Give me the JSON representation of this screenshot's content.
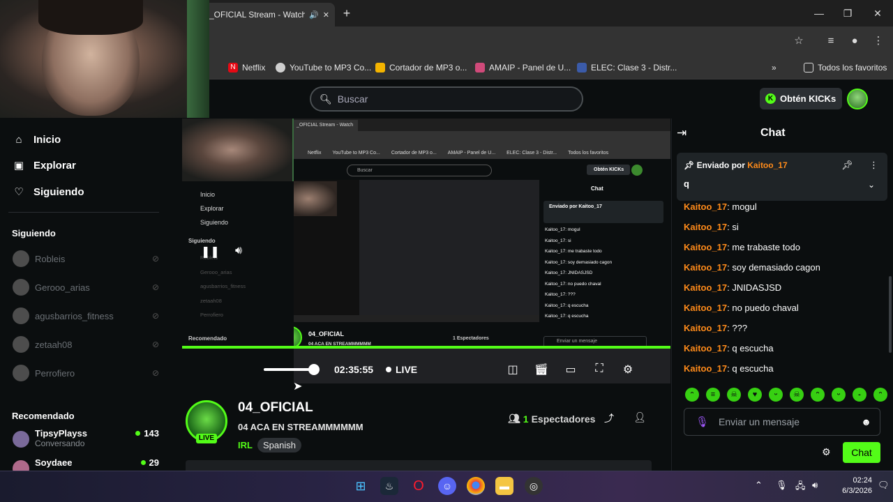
{
  "browser": {
    "tab_title": "_OFICIAL Stream - Watch",
    "bookmarks": [
      {
        "label": "Netflix",
        "color": "#e50914"
      },
      {
        "label": "YouTube to MP3 Co...",
        "color": "#cfcfcf"
      },
      {
        "label": "Cortador de MP3 o...",
        "color": "#f4b400"
      },
      {
        "label": "AMAIP - Panel de U...",
        "color": "#d04a7a"
      },
      {
        "label": "ELEC: Clase 3 - Distr...",
        "color": "#3b5ba9"
      }
    ],
    "all_bookmarks": "Todos los favoritos"
  },
  "header": {
    "search_placeholder": "Buscar",
    "kicks_label": "Obtén KICKs"
  },
  "sidebar": {
    "nav": [
      {
        "label": "Inicio",
        "icon": "home-icon"
      },
      {
        "label": "Explorar",
        "icon": "explore-icon"
      },
      {
        "label": "Siguiendo",
        "icon": "heart-icon"
      }
    ],
    "following_title": "Siguiendo",
    "following": [
      "Robleis",
      "Gerooo_arias",
      "agusbarrios_fitness",
      "zetaah08",
      "Perrofiero"
    ],
    "recommended_title": "Recomendado",
    "recommended": [
      {
        "name": "TipsyPlayss",
        "sub": "Conversando",
        "count": "143"
      },
      {
        "name": "Soydaee",
        "sub": "",
        "count": "29"
      }
    ]
  },
  "player": {
    "time": "02:35:55",
    "live": "LIVE"
  },
  "stream": {
    "channel": "04_OFICIAL",
    "title": "04 ACA EN STREAMMMMMM",
    "category": "IRL",
    "tag": "Spanish",
    "live_badge": "LIVE",
    "viewer_count": "1",
    "viewer_label": "Espectadores"
  },
  "chat": {
    "title": "Chat",
    "pinned_by": "Enviado por",
    "pinned_user": "Kaitoo_17",
    "pinned_msg": "q",
    "messages": [
      {
        "user": "Kaitoo_17",
        "text": ": mogul"
      },
      {
        "user": "Kaitoo_17",
        "text": ": si"
      },
      {
        "user": "Kaitoo_17",
        "text": ": me trabaste todo"
      },
      {
        "user": "Kaitoo_17",
        "text": ": soy demasiado cagon"
      },
      {
        "user": "Kaitoo_17",
        "text": ": JNIDASJSD"
      },
      {
        "user": "Kaitoo_17",
        "text": ": no puedo chaval"
      },
      {
        "user": "Kaitoo_17",
        "text": ": ???"
      },
      {
        "user": "Kaitoo_17",
        "text": ": q escucha"
      },
      {
        "user": "Kaitoo_17",
        "text": ": q escucha"
      }
    ],
    "input_placeholder": "Enviar un mensaje",
    "send_label": "Chat"
  },
  "nested": {
    "tab": "_OFICIAL Stream - Watch",
    "search": "Buscar",
    "kicks": "Obtén KICKs",
    "chat": "Chat",
    "pinned": "Enviado por Kaitoo_17",
    "nav": [
      "Inicio",
      "Explorar",
      "Siguiendo"
    ],
    "following_title": "Siguiendo",
    "recommended_title": "Recomendado",
    "follow": [
      "Robleis",
      "Gerooo_arias",
      "agusbarrios_fitness",
      "zetaah08",
      "Perrofiero"
    ],
    "channel": "04_OFICIAL",
    "title": "04 ACA EN STREAMMMMMM",
    "cat": "IRL",
    "tag": "Spanish",
    "viewers": "1 Espectadores",
    "input": "Enviar un mensaje",
    "bookmarks": [
      "Netflix",
      "YouTube to MP3 Co...",
      "Cortador de MP3 o...",
      "AMAIP - Panel de U...",
      "ELEC: Clase 3 - Distr...",
      "Todos los favoritos"
    ],
    "msgs": [
      "Kaitoo_17: mogul",
      "Kaitoo_17: si",
      "Kaitoo_17: me trabaste todo",
      "Kaitoo_17: soy demasiado cagon",
      "Kaitoo_17: JNIDASJSD",
      "Kaitoo_17: no puedo chaval",
      "Kaitoo_17: ???",
      "Kaitoo_17: q escucha",
      "Kaitoo_17: q escucha"
    ]
  },
  "taskbar": {
    "time": "02:24",
    "date": "6/3/2026"
  },
  "colors": {
    "accent": "#53fc18",
    "username": "#ff8b1a",
    "bg": "#0b0e0f"
  }
}
